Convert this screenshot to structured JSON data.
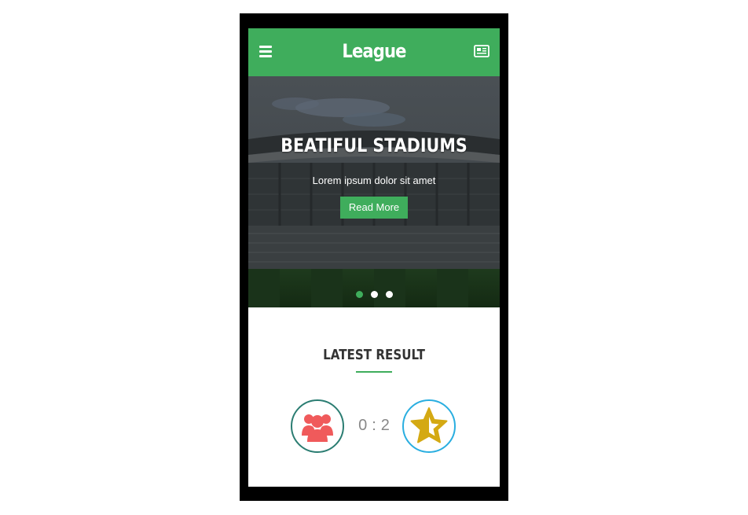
{
  "header": {
    "title": "League",
    "menu_icon": "hamburger-menu-icon",
    "news_icon": "newspaper-icon",
    "color": "#3fad5c"
  },
  "hero": {
    "title": "BEATIFUL STADIUMS",
    "subtitle": "Lorem ipsum dolor sit amet",
    "button_label": "Read More",
    "slide_count": 3,
    "active_slide": 1
  },
  "latest_result": {
    "title": "LATEST RESULT",
    "home_score": "0",
    "separator": ":",
    "away_score": "2",
    "home_logo": "team-people-icon",
    "away_logo": "team-star-icon"
  },
  "colors": {
    "accent": "#3fad5c",
    "home_logo": "#f05a5b",
    "away_logo": "#d4a913"
  }
}
